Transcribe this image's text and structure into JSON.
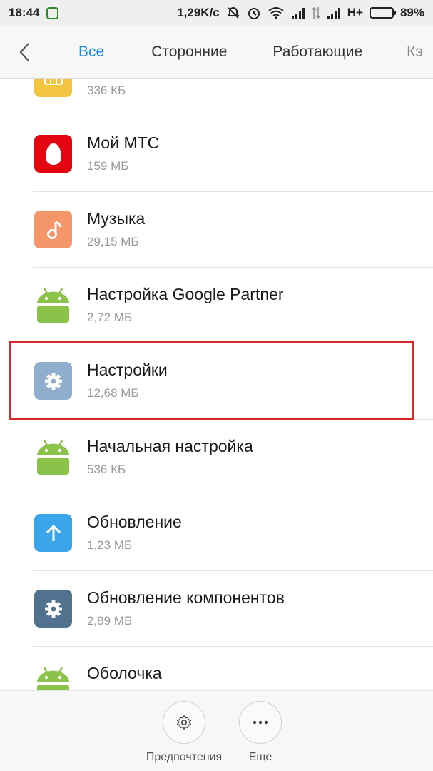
{
  "status_bar": {
    "time": "18:44",
    "network_speed": "1,29K/c",
    "network_type": "H+",
    "battery_percent": "89%",
    "battery_level": 0.89
  },
  "tabs": [
    {
      "label": "Все",
      "active": true
    },
    {
      "label": "Сторонние",
      "active": false
    },
    {
      "label": "Работающие",
      "active": false
    },
    {
      "label": "Кэ",
      "active": false
    }
  ],
  "apps": [
    {
      "name": "",
      "size": "336 КБ",
      "icon": "sim-card-icon",
      "color": "#f5c542"
    },
    {
      "name": "Мой МТС",
      "size": "159 МБ",
      "icon": "mts-egg-icon",
      "color": "#e30611"
    },
    {
      "name": "Музыка",
      "size": "29,15 МБ",
      "icon": "music-note-icon",
      "color": "#f4956a"
    },
    {
      "name": "Настройка Google Partner",
      "size": "2,72 МБ",
      "icon": "android-icon",
      "color": "#8bc34a"
    },
    {
      "name": "Настройки",
      "size": "12,68 МБ",
      "icon": "gear-icon",
      "color": "#8faecd"
    },
    {
      "name": "Начальная настройка",
      "size": "536 КБ",
      "icon": "android-icon",
      "color": "#8bc34a"
    },
    {
      "name": "Обновление",
      "size": "1,23 МБ",
      "icon": "arrow-up-icon",
      "color": "#3aa5e8"
    },
    {
      "name": "Обновление компонентов",
      "size": "2,89 МБ",
      "icon": "gear-icon",
      "color": "#50728f"
    },
    {
      "name": "Оболочка",
      "size": "",
      "icon": "android-icon",
      "color": "#8bc34a"
    }
  ],
  "bottom_actions": [
    {
      "label": "Предпочтения",
      "icon": "gear-outline-icon"
    },
    {
      "label": "Еще",
      "icon": "more-dots-icon"
    }
  ],
  "highlight_color": "#d9252c",
  "accent_color": "#1e8de8"
}
